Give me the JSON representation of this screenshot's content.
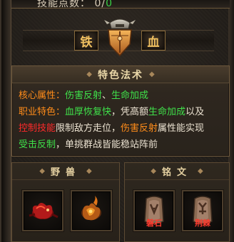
{
  "skill_points": {
    "label": "技能点数：",
    "current": "0/",
    "max": "0"
  },
  "header": {
    "left_char": "铁",
    "right_char": "血",
    "emblem_icon": "shield-helmet-emblem"
  },
  "description": {
    "title": "特色法术",
    "lines": [
      [
        {
          "text": "核心属性：",
          "color": "orange"
        },
        {
          "text": "伤害反射",
          "color": "green"
        },
        {
          "text": "、",
          "color": "white"
        },
        {
          "text": "生命加成",
          "color": "green"
        }
      ],
      [
        {
          "text": "职业特色：",
          "color": "orange"
        },
        {
          "text": "血厚恢复快",
          "color": "green"
        },
        {
          "text": "，凭高额",
          "color": "white"
        },
        {
          "text": "生命加成",
          "color": "green"
        },
        {
          "text": "以及",
          "color": "white"
        }
      ],
      [
        {
          "text": "控制技能",
          "color": "red"
        },
        {
          "text": "限制敌方走位，",
          "color": "white"
        },
        {
          "text": "伤害反射",
          "color": "orange"
        },
        {
          "text": "属性能实现",
          "color": "white"
        }
      ],
      [
        {
          "text": "受击反制",
          "color": "green"
        },
        {
          "text": "，单挑群战皆能稳站阵前",
          "color": "white"
        }
      ]
    ]
  },
  "beast": {
    "title": "野兽",
    "slots": [
      {
        "icon": "red-beast-icon"
      },
      {
        "icon": "fire-beast-icon"
      }
    ]
  },
  "rune": {
    "title": "铭文",
    "slots": [
      {
        "icon": "rune-stone-icon",
        "label": "磐石"
      },
      {
        "icon": "rune-stone-icon",
        "label": "荆棘"
      }
    ]
  },
  "colors": {
    "orange": "#ff8c1a",
    "green": "#3fe04a",
    "red": "#ff2a2a",
    "gold": "#f0c060"
  }
}
